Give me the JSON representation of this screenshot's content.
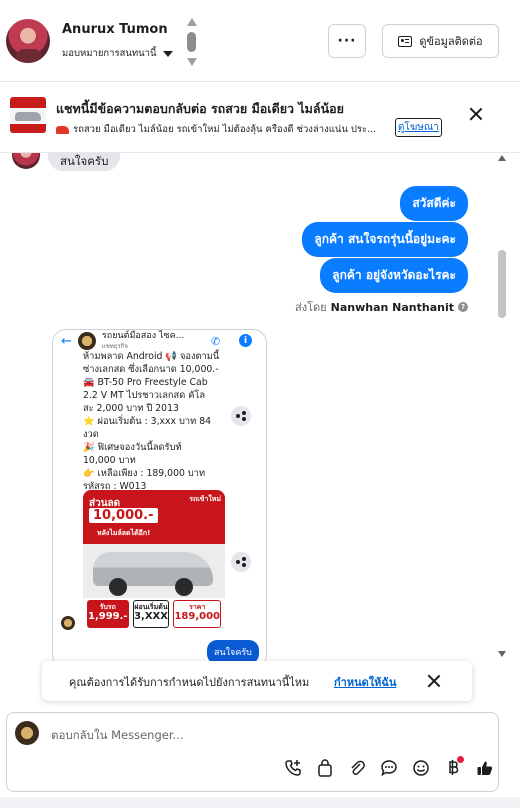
{
  "header": {
    "contact_name": "Anurux Tumon",
    "assign_label": "มอบหมายการสนทนานี้",
    "more_label": "···",
    "contact_button_label": "ดูข้อมูลติดต่อ"
  },
  "ad_banner": {
    "title": "แชทนี้มีข้อความตอบกลับต่อ รถสวย มือเดียว ไมล์น้อย",
    "subtitle": "รถสวย มือเดียว ไมล์น้อย รถเข้าใหม่ ไม่ต้องลุ้น ครืองดี ช่วงล่างแน่น ประ...",
    "link_label": "ดูโฆษณา"
  },
  "messages": {
    "incoming_top": "สนใจครับ",
    "outgoing": [
      "สวัสดีค่ะ",
      "ลูกค้า สนใจรถรุ่นนี้อยู่มะคะ",
      "ลูกค้า อยู่จังหวัดอะไรคะ"
    ],
    "sent_by_prefix": "ส่งโดย",
    "sent_by_name": "Nanwhan Nanthanit",
    "info_glyph": "?"
  },
  "shared_screenshot": {
    "page_name": "รถยนต์มือสอง ไซค...",
    "page_sub": "แชทธุรกิจ",
    "info_glyph": "i",
    "post_text": "ห้ามพลาด Android 📢 จองตามนี้ \nซ่างเลกสด ซึ่งเลือกนาด 10,000.-\n🚘 BT-50 Pro Freestyle Cab\n2.2 V MT ไปรชาวเลกสด คัโล\nสะ 2,000 บาท ปี 2013\n⭐ ผ่อนเริ่มต้น : 3,xxx บาท 84\nงวด\n🎉 ฟิเศษจองวันนี้ลดรับท์\n10,000 บาท\n👉 เหลือเพียง : 189,000 บาท\nรหัสรถ : W013",
    "promo_title": "ส่วนลด",
    "promo_amount": "10,000.-",
    "promo_sub": "หลังไมล์ลดได้อีก!",
    "promo_tag": "รถเข้าใหม่",
    "price_down_label": "รับรถ",
    "price_down": "1,999.-",
    "price_month_label": "ผ่อนเริ่มต้น",
    "price_month": "3,XXX",
    "price_total_label": "ราคา",
    "price_total": "189,000",
    "reply_label": "สนใจครับ"
  },
  "notification": {
    "text": "คุณต้องการได้รับการกำหนดไปยังการสนทนานี้ไหม",
    "link_label": "กำหนดให้ฉัน"
  },
  "composer": {
    "placeholder": "ตอบกลับใน Messenger...",
    "tools": [
      "call-add-icon",
      "shopping-bag-icon",
      "paperclip-icon",
      "chat-bubble-icon",
      "emoji-icon",
      "baht-icon",
      "thumbs-up-icon"
    ]
  },
  "colors": {
    "accent": "#0a7cff",
    "link": "#0064d1",
    "incoming_bubble": "#e4e6eb",
    "promo_red": "#c8151b"
  }
}
